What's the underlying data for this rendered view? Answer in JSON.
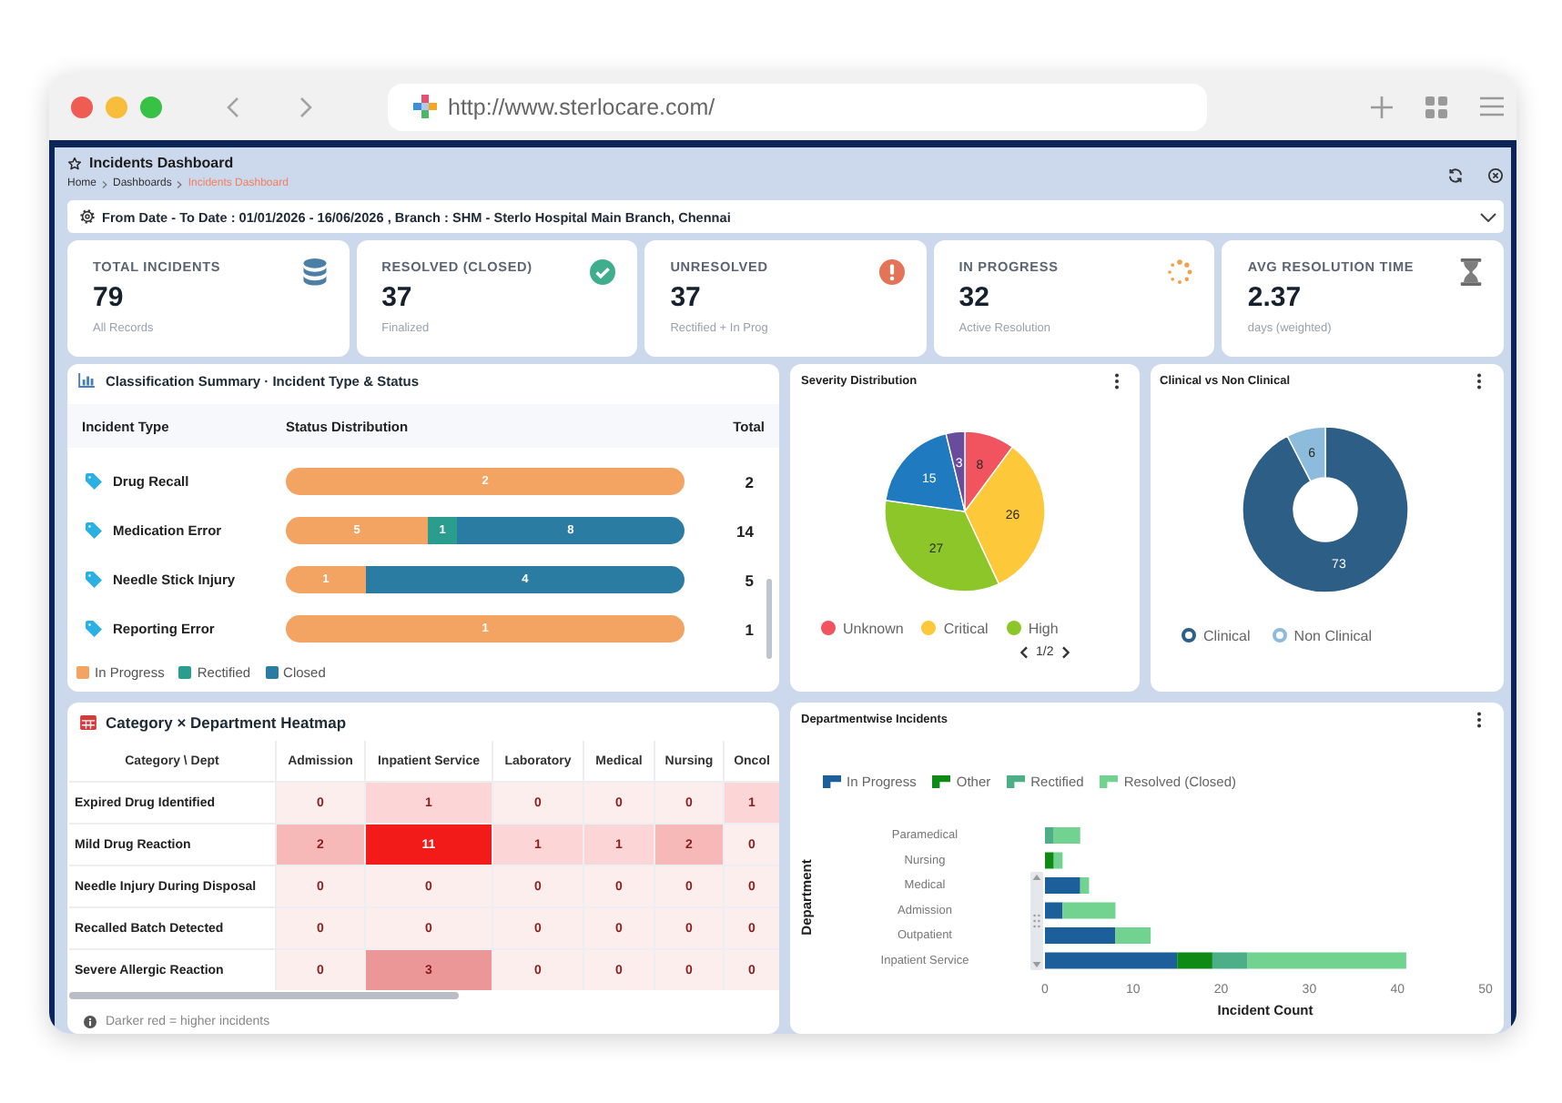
{
  "browser": {
    "url": "http://www.sterlocare.com/"
  },
  "header": {
    "title": "Incidents Dashboard",
    "breadcrumb": [
      {
        "label": "Home",
        "current": false
      },
      {
        "label": "Dashboards",
        "current": false
      },
      {
        "label": "Incidents Dashboard",
        "current": true
      }
    ]
  },
  "filter": {
    "text": "From Date - To Date : 01/01/2026 - 16/06/2026 , Branch : SHM - Sterlo Hospital Main Branch, Chennai",
    "expanded": false
  },
  "kpis": [
    {
      "kind": "total",
      "label": "TOTAL INCIDENTS",
      "value": "79",
      "caption": "All Records"
    },
    {
      "kind": "resolved",
      "label": "RESOLVED (CLOSED)",
      "value": "37",
      "caption": "Finalized"
    },
    {
      "kind": "unresolved",
      "label": "UNRESOLVED",
      "value": "37",
      "caption": "Rectified + In Prog"
    },
    {
      "kind": "in_progress",
      "label": "IN PROGRESS",
      "value": "32",
      "caption": "Active Resolution"
    },
    {
      "kind": "avg_time",
      "label": "AVG RESOLUTION TIME",
      "value": "2.37",
      "caption": "days (weighted)"
    }
  ],
  "classification": {
    "title": "Classification Summary · Incident Type & Status",
    "columns": [
      "Incident Type",
      "Status Distribution",
      "Total"
    ],
    "rows": [
      {
        "name": "Drug Recall",
        "segments": [
          {
            "kind": "in_progress",
            "value": "2"
          }
        ],
        "total": "2"
      },
      {
        "name": "Medication Error",
        "segments": [
          {
            "kind": "in_progress",
            "value": "5"
          },
          {
            "kind": "rectified",
            "value": "1"
          },
          {
            "kind": "closed",
            "value": "8"
          }
        ],
        "total": "14"
      },
      {
        "name": "Needle Stick Injury",
        "segments": [
          {
            "kind": "in_progress",
            "value": "1"
          },
          {
            "kind": "closed",
            "value": "4"
          }
        ],
        "total": "5"
      },
      {
        "name": "Reporting Error",
        "segments": [
          {
            "kind": "in_progress",
            "value": "1"
          }
        ],
        "total": "1"
      }
    ],
    "legend": [
      {
        "kind": "in_progress",
        "label": "In Progress",
        "color": "#f3a462"
      },
      {
        "kind": "rectified",
        "label": "Rectified",
        "color": "#2a9d8f"
      },
      {
        "kind": "closed",
        "label": "Closed",
        "color": "#2a7ca2"
      }
    ]
  },
  "severity": {
    "title": "Severity Distribution",
    "chart_data": {
      "type": "pie",
      "categories": [
        "Unknown",
        "Critical",
        "High",
        null,
        null
      ],
      "values": [
        8,
        26,
        27,
        15,
        3
      ],
      "colors": [
        "#f2545f",
        "#fdc83a",
        "#8cc629",
        "#1f7ac0",
        "#6a4c9c"
      ],
      "data_labels": true
    },
    "legend_page": "1/2"
  },
  "clinical": {
    "title": "Clinical vs Non Clinical",
    "chart_data": {
      "type": "donut",
      "categories": [
        "Clinical",
        "Non Clinical"
      ],
      "values": [
        73,
        6
      ],
      "colors": [
        "#2d5f86",
        "#8dbbdc"
      ],
      "data_labels": true
    }
  },
  "heatmap": {
    "title": "Category × Department Heatmap",
    "corner": "Category \\ Dept",
    "columns": [
      "Admission",
      "Inpatient Service",
      "Laboratory",
      "Medical",
      "Nursing",
      "Oncol"
    ],
    "rows": [
      {
        "category": "Expired Drug Identified",
        "cells": [
          {
            "value": "0",
            "color": "#fdeeee"
          },
          {
            "value": "1",
            "color": "#fcd6d6"
          },
          {
            "value": "0",
            "color": "#fdeeee"
          },
          {
            "value": "0",
            "color": "#fdeeee"
          },
          {
            "value": "0",
            "color": "#fdeeee"
          },
          {
            "value": "1",
            "color": "#fcd6d6"
          }
        ]
      },
      {
        "category": "Mild Drug Reaction",
        "cells": [
          {
            "value": "2",
            "color": "#f7b8b8"
          },
          {
            "value": "11",
            "color": "#f31a1a"
          },
          {
            "value": "1",
            "color": "#fcd6d6"
          },
          {
            "value": "1",
            "color": "#fcd6d6"
          },
          {
            "value": "2",
            "color": "#f7b8b8"
          },
          {
            "value": "0",
            "color": "#fdeeee"
          }
        ]
      },
      {
        "category": "Needle Injury During Disposal",
        "cells": [
          {
            "value": "0",
            "color": "#fdeeee"
          },
          {
            "value": "0",
            "color": "#fdeeee"
          },
          {
            "value": "0",
            "color": "#fdeeee"
          },
          {
            "value": "0",
            "color": "#fdeeee"
          },
          {
            "value": "0",
            "color": "#fdeeee"
          },
          {
            "value": "0",
            "color": "#fdeeee"
          }
        ]
      },
      {
        "category": "Recalled Batch Detected",
        "cells": [
          {
            "value": "0",
            "color": "#fdeeee"
          },
          {
            "value": "0",
            "color": "#fdeeee"
          },
          {
            "value": "0",
            "color": "#fdeeee"
          },
          {
            "value": "0",
            "color": "#fdeeee"
          },
          {
            "value": "0",
            "color": "#fdeeee"
          },
          {
            "value": "0",
            "color": "#fdeeee"
          }
        ]
      },
      {
        "category": "Severe Allergic Reaction",
        "cells": [
          {
            "value": "0",
            "color": "#fdeeee"
          },
          {
            "value": "3",
            "color": "#ec9797"
          },
          {
            "value": "0",
            "color": "#fdeeee"
          },
          {
            "value": "0",
            "color": "#fdeeee"
          },
          {
            "value": "0",
            "color": "#fdeeee"
          },
          {
            "value": "0",
            "color": "#fdeeee"
          }
        ]
      }
    ],
    "note": "Darker red = higher incidents"
  },
  "departments": {
    "title": "Departmentwise Incidents",
    "chart_data": {
      "type": "bar",
      "orientation": "horizontal",
      "stacked": true,
      "categories": [
        "Paramedical",
        "Nursing",
        "Medical",
        "Admission",
        "Outpatient",
        "Inpatient Service"
      ],
      "series": [
        {
          "name": "In Progress",
          "color": "#1d5f9b",
          "values": [
            0,
            0,
            4,
            2,
            8,
            15
          ]
        },
        {
          "name": "Other",
          "color": "#0f8a14",
          "values": [
            0,
            1,
            0,
            0,
            0,
            4
          ]
        },
        {
          "name": "Rectified",
          "color": "#4daf88",
          "values": [
            1,
            0,
            0,
            0,
            0,
            4
          ]
        },
        {
          "name": "Resolved (Closed)",
          "color": "#72d390",
          "values": [
            3,
            1,
            1,
            6,
            4,
            18
          ]
        }
      ],
      "xlabel": "Incident Count",
      "ylabel": "Department",
      "xlim": [
        0,
        50
      ],
      "xticks": [
        0,
        10,
        20,
        30,
        40,
        50
      ]
    }
  }
}
